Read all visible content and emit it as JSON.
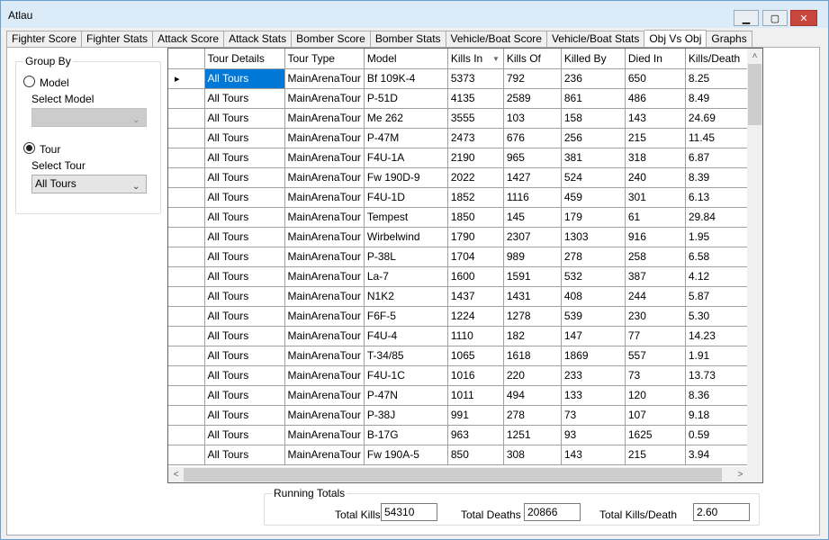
{
  "window": {
    "title": "Atlau",
    "minimize": "▁",
    "maximize": "▢",
    "close": "✕"
  },
  "tabs": [
    "Fighter Score",
    "Fighter Stats",
    "Attack Score",
    "Attack Stats",
    "Bomber Score",
    "Bomber Stats",
    "Vehicle/Boat Score",
    "Vehicle/Boat Stats",
    "Obj Vs Obj",
    "Graphs"
  ],
  "active_tab": "Obj Vs Obj",
  "group_by": {
    "title": "Group By",
    "model_label": "Model",
    "select_model_label": "Select Model",
    "select_model_value": "",
    "tour_label": "Tour",
    "select_tour_label": "Select Tour",
    "select_tour_value": "All Tours",
    "selected": "Tour"
  },
  "grid": {
    "columns": [
      "Tour Details",
      "Tour Type",
      "Model",
      "Kills In",
      "Kills Of",
      "Killed By",
      "Died In",
      "Kills/Death"
    ],
    "sorted_column": "Kills In",
    "rows": [
      [
        "All Tours",
        "MainArenaTour",
        "Bf 109K-4",
        "5373",
        "792",
        "236",
        "650",
        "8.25"
      ],
      [
        "All Tours",
        "MainArenaTour",
        "P-51D",
        "4135",
        "2589",
        "861",
        "486",
        "8.49"
      ],
      [
        "All Tours",
        "MainArenaTour",
        "Me 262",
        "3555",
        "103",
        "158",
        "143",
        "24.69"
      ],
      [
        "All Tours",
        "MainArenaTour",
        "P-47M",
        "2473",
        "676",
        "256",
        "215",
        "11.45"
      ],
      [
        "All Tours",
        "MainArenaTour",
        "F4U-1A",
        "2190",
        "965",
        "381",
        "318",
        "6.87"
      ],
      [
        "All Tours",
        "MainArenaTour",
        "Fw 190D-9",
        "2022",
        "1427",
        "524",
        "240",
        "8.39"
      ],
      [
        "All Tours",
        "MainArenaTour",
        "F4U-1D",
        "1852",
        "1116",
        "459",
        "301",
        "6.13"
      ],
      [
        "All Tours",
        "MainArenaTour",
        "Tempest",
        "1850",
        "145",
        "179",
        "61",
        "29.84"
      ],
      [
        "All Tours",
        "MainArenaTour",
        "Wirbelwind",
        "1790",
        "2307",
        "1303",
        "916",
        "1.95"
      ],
      [
        "All Tours",
        "MainArenaTour",
        "P-38L",
        "1704",
        "989",
        "278",
        "258",
        "6.58"
      ],
      [
        "All Tours",
        "MainArenaTour",
        "La-7",
        "1600",
        "1591",
        "532",
        "387",
        "4.12"
      ],
      [
        "All Tours",
        "MainArenaTour",
        "N1K2",
        "1437",
        "1431",
        "408",
        "244",
        "5.87"
      ],
      [
        "All Tours",
        "MainArenaTour",
        "F6F-5",
        "1224",
        "1278",
        "539",
        "230",
        "5.30"
      ],
      [
        "All Tours",
        "MainArenaTour",
        "F4U-4",
        "1110",
        "182",
        "147",
        "77",
        "14.23"
      ],
      [
        "All Tours",
        "MainArenaTour",
        "T-34/85",
        "1065",
        "1618",
        "1869",
        "557",
        "1.91"
      ],
      [
        "All Tours",
        "MainArenaTour",
        "F4U-1C",
        "1016",
        "220",
        "233",
        "73",
        "13.73"
      ],
      [
        "All Tours",
        "MainArenaTour",
        "P-47N",
        "1011",
        "494",
        "133",
        "120",
        "8.36"
      ],
      [
        "All Tours",
        "MainArenaTour",
        "P-38J",
        "991",
        "278",
        "73",
        "107",
        "9.18"
      ],
      [
        "All Tours",
        "MainArenaTour",
        "B-17G",
        "963",
        "1251",
        "93",
        "1625",
        "0.59"
      ],
      [
        "All Tours",
        "MainArenaTour",
        "Fw 190A-5",
        "850",
        "308",
        "143",
        "215",
        "3.94"
      ]
    ]
  },
  "running_totals": {
    "title": "Running Totals",
    "total_kills_label": "Total Kills",
    "total_kills": "54310",
    "total_deaths_label": "Total Deaths",
    "total_deaths": "20866",
    "total_kd_label": "Total Kills/Death",
    "total_kd": "2.60"
  }
}
